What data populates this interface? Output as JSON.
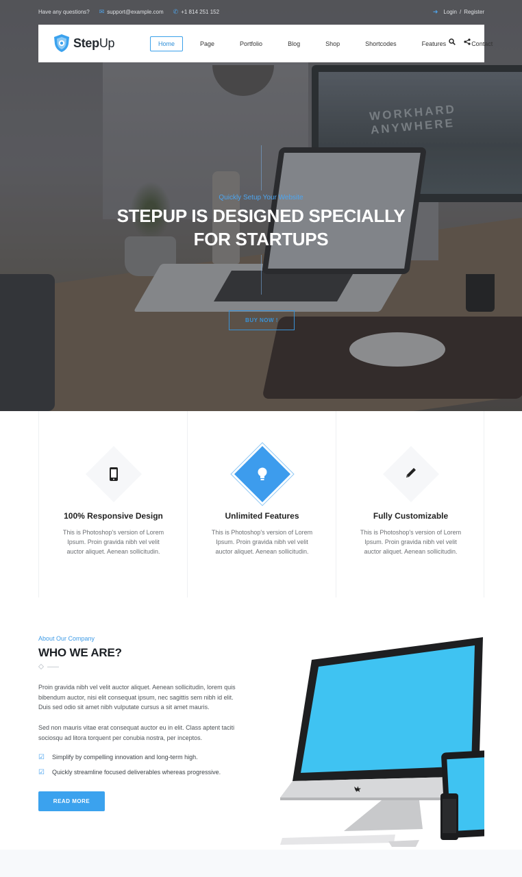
{
  "topbar": {
    "question": "Have any questions?",
    "email": "support@example.com",
    "phone": "+1 814 251 152",
    "login": "Login",
    "divider": "/",
    "register": "Register"
  },
  "brand": {
    "name_bold": "Step",
    "name_light": "Up",
    "accent": "#3ba2ee"
  },
  "nav": {
    "items": [
      {
        "label": "Home",
        "active": true
      },
      {
        "label": "Page"
      },
      {
        "label": "Portfolio"
      },
      {
        "label": "Blog"
      },
      {
        "label": "Shop"
      },
      {
        "label": "Shortcodes"
      },
      {
        "label": "Features"
      },
      {
        "label": "Contact"
      }
    ],
    "icons": [
      "search-icon",
      "share-icon"
    ]
  },
  "hero": {
    "subtitle": "Quickly Setup Your Website",
    "title_line1": "STEPUP IS DESIGNED SPECIALLY",
    "title_line2": "FOR STARTUPS",
    "button": "BUY NOW !",
    "screen_text_1": "WORKHARD",
    "screen_text_2": "ANYWHERE"
  },
  "features": [
    {
      "title": "100% Responsive Design",
      "desc": "This is Photoshop's version of Lorem Ipsum. Proin gravida nibh vel velit auctor aliquet. Aenean sollicitudin.",
      "icon": "mobile-icon"
    },
    {
      "title": "Unlimited Features",
      "desc": "This is Photoshop's version of Lorem Ipsum. Proin gravida nibh vel velit auctor aliquet. Aenean sollicitudin.",
      "icon": "lightbulb-icon"
    },
    {
      "title": "Fully Customizable",
      "desc": "This is Photoshop's version of Lorem Ipsum. Proin gravida nibh vel velit auctor aliquet. Aenean sollicitudin.",
      "icon": "pencil-icon"
    }
  ],
  "about": {
    "subtitle": "About Our Company",
    "title": "WHO WE ARE?",
    "para1": "Proin gravida nibh vel velit auctor aliquet. Aenean sollicitudin, lorem quis bibendum auctor, nisi elit consequat ipsum, nec sagittis sem nibh id elit. Duis sed odio sit amet nibh vulputate cursus a sit amet mauris.",
    "para2": "Sed non mauris vitae erat consequat auctor eu in elit. Class aptent taciti sociosqu ad litora torquent per conubia nostra, per inceptos.",
    "checks": [
      "Simplify by compelling innovation and long-term high.",
      "Quickly streamline focused deliverables whereas progressive."
    ],
    "button": "READ MORE"
  }
}
